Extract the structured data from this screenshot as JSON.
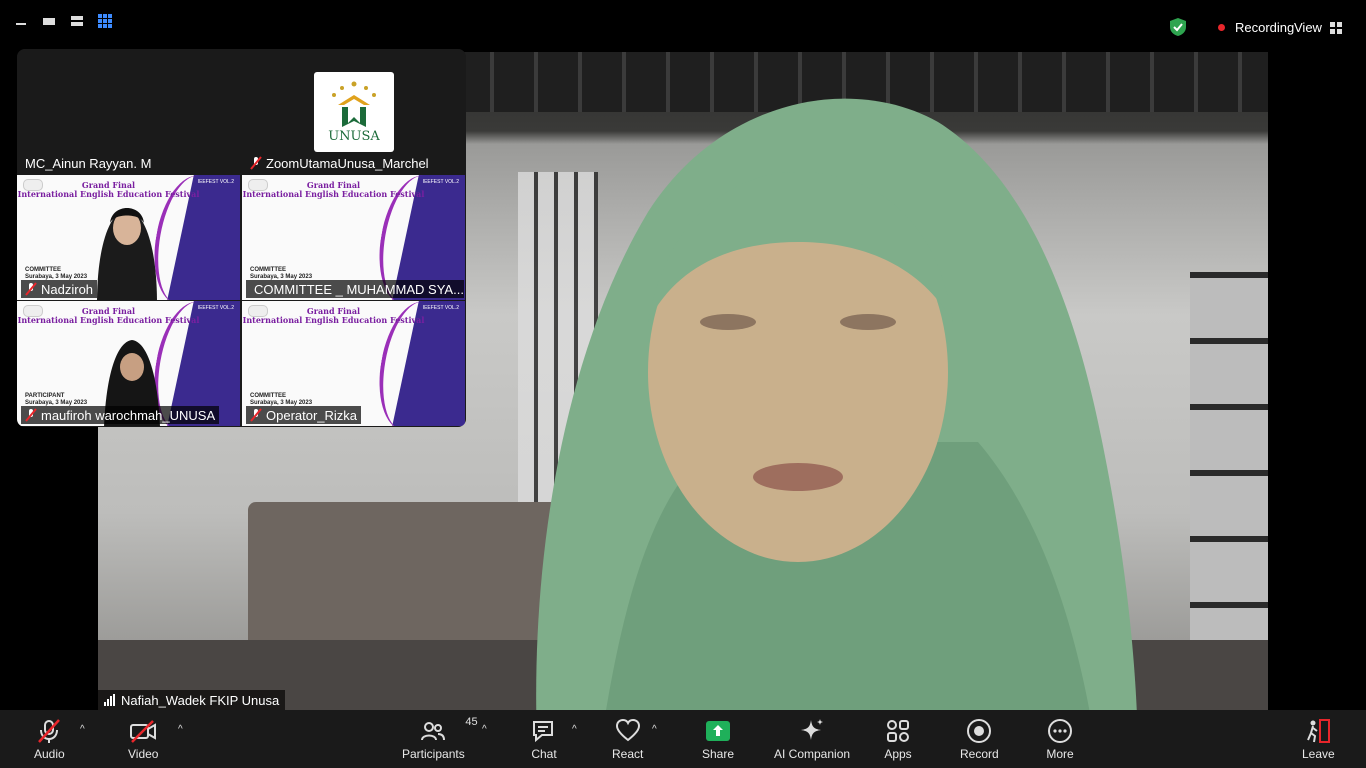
{
  "colors": {
    "recording_dot": "#e8262b",
    "shield_green": "#2ea44f",
    "share_green": "#1fb05a",
    "toolbar_bg": "#1a1a1a"
  },
  "top": {
    "recording_label": "Recording",
    "view_label": "View"
  },
  "main_video": {
    "speaker_name": "Nafiah_Wadek FKIP Unusa"
  },
  "gallery": {
    "tiles": [
      {
        "name": "MC_Ainun Rayyan. M",
        "muted": false
      },
      {
        "name": "ZoomUtamaUnusa_Marchel",
        "muted": true,
        "logo_text": "UNUSA"
      },
      {
        "name": "Nadziroh",
        "muted": true,
        "banner_role": "COMMITTEE"
      },
      {
        "name": "COMMITTEE _ MUHAMMAD SYA...",
        "muted": true,
        "banner_role": "COMMITTEE"
      },
      {
        "name": "maufiroh warochmah_UNUSA",
        "muted": true,
        "banner_role": "PARTICIPANT"
      },
      {
        "name": "Operator_Rizka",
        "muted": true,
        "banner_role": "COMMITTEE"
      }
    ],
    "banner_title_1": "Grand Final",
    "banner_title_2": "International English Education Festival",
    "banner_fest": "IEEFEST VOL.2",
    "banner_date": "Surabaya, 3 May 2023"
  },
  "toolbar": {
    "audio": "Audio",
    "video": "Video",
    "participants": "Participants",
    "participants_count": "45",
    "chat": "Chat",
    "react": "React",
    "share": "Share",
    "ai_companion": "AI Companion",
    "apps": "Apps",
    "record": "Record",
    "more": "More",
    "leave": "Leave"
  }
}
